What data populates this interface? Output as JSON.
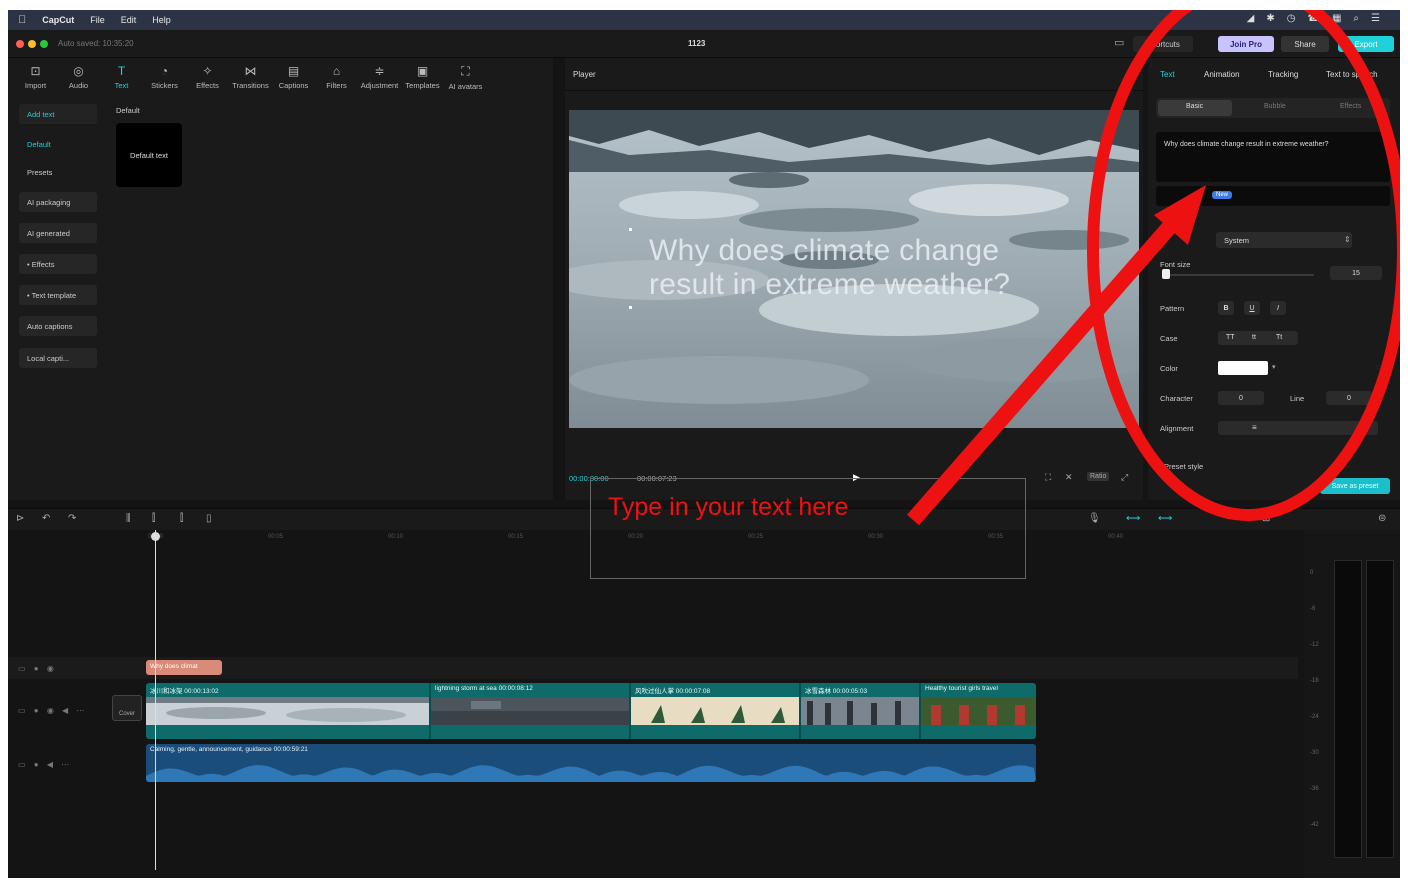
{
  "menubar": {
    "app": "CapCut",
    "items": [
      "File",
      "Edit",
      "Help"
    ]
  },
  "titlebar": {
    "autosave": "Auto saved: 10:35:20",
    "title": "1123",
    "shortcuts": "Shortcuts",
    "join_pro": "Join Pro",
    "share": "Share",
    "export": "Export"
  },
  "toolbar": {
    "tools": [
      {
        "icon": "import-icon",
        "label": "Import"
      },
      {
        "icon": "audio-icon",
        "label": "Audio"
      },
      {
        "icon": "text-icon",
        "label": "Text"
      },
      {
        "icon": "stickers-icon",
        "label": "Stickers"
      },
      {
        "icon": "effects-icon",
        "label": "Effects"
      },
      {
        "icon": "transitions-icon",
        "label": "Transitions"
      },
      {
        "icon": "captions-icon",
        "label": "Captions"
      },
      {
        "icon": "filters-icon",
        "label": "Filters"
      },
      {
        "icon": "adjustment-icon",
        "label": "Adjustment"
      },
      {
        "icon": "templates-icon",
        "label": "Templates"
      },
      {
        "icon": "ai-avatars-icon",
        "label": "AI avatars"
      }
    ]
  },
  "sidebar": {
    "items": [
      {
        "label": "Add text"
      },
      {
        "label": "Default"
      },
      {
        "label": "Presets"
      },
      {
        "label": "AI packaging"
      },
      {
        "label": "AI generated"
      },
      {
        "label": "• Effects"
      },
      {
        "label": "• Text template"
      },
      {
        "label": "Auto captions"
      },
      {
        "label": "Local capti..."
      }
    ]
  },
  "library": {
    "section": "Default",
    "card": "Default text"
  },
  "player": {
    "header": "Player",
    "caption_line1": "Why does climate change",
    "caption_line2": "result in extreme weather?",
    "timecode_current": "00:00:00:00",
    "timecode_total": "00:00:07:23",
    "ratio": "Ratio"
  },
  "inspector": {
    "tabs": [
      "Text",
      "Animation",
      "Tracking",
      "Text to speech"
    ],
    "subtabs": [
      "Basic",
      "Bubble",
      "Effects"
    ],
    "text_value": "Why does climate change result in extreme weather?",
    "new_badge": "New",
    "font_value": "System",
    "font_size_label": "Font size",
    "font_size_value": "15",
    "pattern_label": "Pattern",
    "pattern_buttons": [
      "B",
      "U",
      "I"
    ],
    "case_label": "Case",
    "case_buttons": [
      "TT",
      "tt",
      "Tt"
    ],
    "color_label": "Color",
    "character_label": "Character",
    "character_value": "0",
    "line_label": "Line",
    "line_value": "0",
    "alignment_label": "Alignment",
    "preset_style": "Preset style",
    "save_preset": "Save as preset"
  },
  "timeline": {
    "ruler": [
      "00:00",
      "00:05",
      "00:10",
      "00:15",
      "00:20",
      "00:25",
      "00:30",
      "00:35",
      "00:40"
    ],
    "text_clip": "Why does climat",
    "cover_label": "Cover",
    "video_clips": [
      {
        "label": "冰川和冰架  00:00:13:02"
      },
      {
        "label": "lightning storm at sea  00:00:08:12"
      },
      {
        "label": "风吹过仙人掌  00:00:07:08"
      },
      {
        "label": "冰雪森林  00:00:05:03"
      },
      {
        "label": "Healthy tourist girls travel"
      }
    ],
    "audio_label": "Calming, gentle, announcement, guidance  00:00:59:21"
  },
  "meter": {
    "levels": [
      "0",
      "-6",
      "-12",
      "-18",
      "-24",
      "-30",
      "-36",
      "-42"
    ]
  },
  "annotation": {
    "text": "Type in your text here",
    "color": "#ee1111"
  },
  "colors": {
    "accent": "#1fd1db",
    "text_clip": "#d98a78",
    "video_track": "#0f6a6a",
    "audio_track": "#1b4d7a"
  }
}
